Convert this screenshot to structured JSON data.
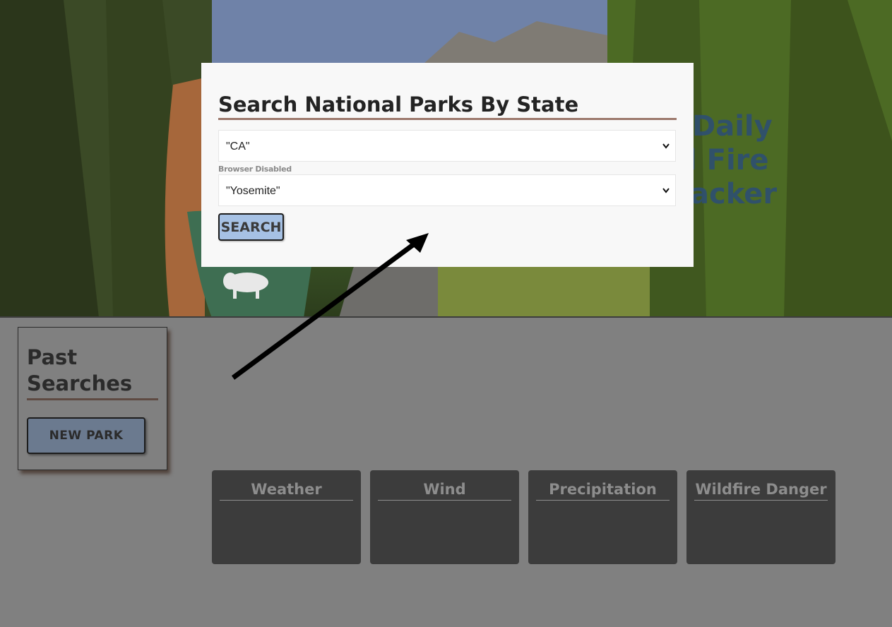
{
  "hero": {
    "title_lines": [
      "Daily",
      "l Fire",
      "acker"
    ]
  },
  "modal": {
    "title": "Search National Parks By State",
    "state_select": {
      "value": "\"CA\""
    },
    "disabled_note": "Browser Disabled",
    "park_select": {
      "value": "\"Yosemite\""
    },
    "search_label": "SEARCH"
  },
  "past_searches": {
    "title": "Past Searches",
    "new_park_label": "NEW PARK"
  },
  "cards": [
    {
      "title": "Weather"
    },
    {
      "title": "Wind"
    },
    {
      "title": "Precipitation"
    },
    {
      "title": "Wildfire Danger"
    }
  ],
  "icons": {
    "select_chevron": "chevron-down-icon",
    "arrow": "arrow-icon",
    "bison": "bison-icon"
  },
  "colors": {
    "modal_bg": "#f8f8f8",
    "title_underline": "#9c786c",
    "search_button": "#a6c1e4",
    "new_park_button": "#6b7a8f",
    "card_bg": "#3c3c3c",
    "page_bg": "#808080"
  }
}
